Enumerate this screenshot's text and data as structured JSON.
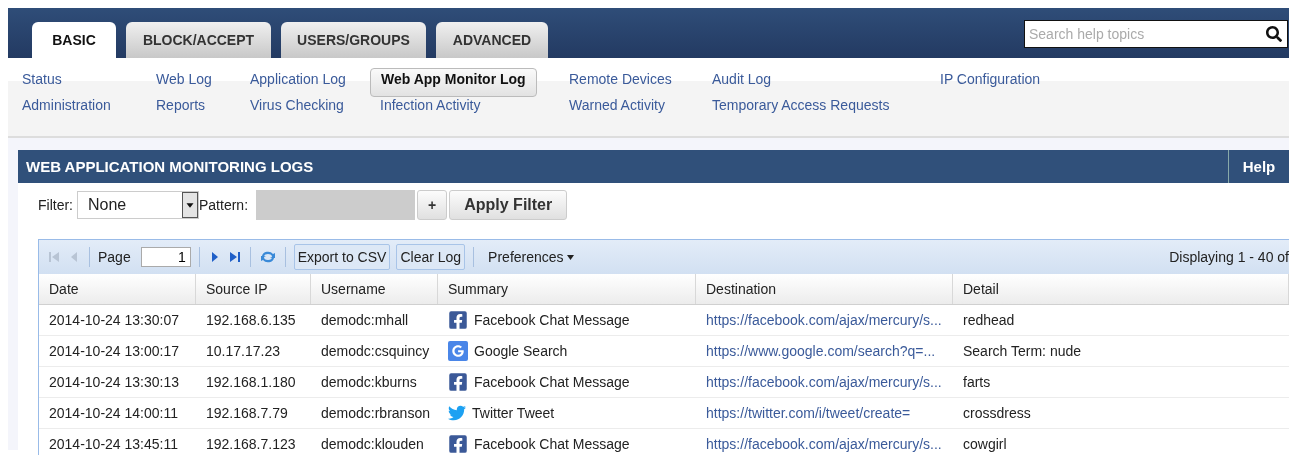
{
  "tabs": [
    {
      "label": "BASIC",
      "selected": true
    },
    {
      "label": "BLOCK/ACCEPT",
      "selected": false
    },
    {
      "label": "USERS/GROUPS",
      "selected": false
    },
    {
      "label": "ADVANCED",
      "selected": false
    }
  ],
  "search": {
    "placeholder": "Search help topics"
  },
  "subnav": [
    {
      "label": "Status",
      "selected": false
    },
    {
      "label": "Web Log",
      "selected": false
    },
    {
      "label": "Application Log",
      "selected": false
    },
    {
      "label": "Web App Monitor Log",
      "selected": true
    },
    {
      "label": "Remote Devices",
      "selected": false
    },
    {
      "label": "Audit Log",
      "selected": false
    },
    {
      "label": "IP Configuration",
      "selected": false
    },
    {
      "label": "Administration",
      "selected": false
    },
    {
      "label": "Reports",
      "selected": false
    },
    {
      "label": "Virus Checking",
      "selected": false
    },
    {
      "label": "Infection Activity",
      "selected": false
    },
    {
      "label": "Warned Activity",
      "selected": false
    },
    {
      "label": "Temporary Access Requests",
      "selected": false
    }
  ],
  "panel": {
    "title": "WEB APPLICATION MONITORING LOGS",
    "help": "Help"
  },
  "filter": {
    "label": "Filter:",
    "value": "None",
    "pattern_label": "Pattern:",
    "pattern_disabled": true,
    "add": "+",
    "apply": "Apply Filter"
  },
  "toolbar": {
    "first_disabled": true,
    "prev_disabled": true,
    "page_label": "Page",
    "page": "1",
    "export": "Export to CSV",
    "clear": "Clear Log",
    "preferences": "Preferences",
    "display": "Displaying 1 - 40 of"
  },
  "table": {
    "columns": [
      "Date",
      "Source IP",
      "Username",
      "Summary",
      "Destination",
      "Detail"
    ],
    "rows": [
      {
        "date": "2014-10-24 13:30:07",
        "ip": "192.168.6.135",
        "user": "demodc:mhall",
        "kind": "facebook",
        "summary": "Facebook Chat Message",
        "destination": "https://facebook.com/ajax/mercury/s...",
        "detail": "redhead"
      },
      {
        "date": "2014-10-24 13:00:17",
        "ip": "10.17.17.23",
        "user": "demodc:csquincy",
        "kind": "google",
        "summary": "Google Search",
        "destination": "https://www.google.com/search?q=...",
        "detail": "Search Term: nude"
      },
      {
        "date": "2014-10-24 13:30:13",
        "ip": "192.168.1.180",
        "user": "demodc:kburns",
        "kind": "facebook",
        "summary": "Facebook Chat Message",
        "destination": "https://facebook.com/ajax/mercury/s...",
        "detail": "farts"
      },
      {
        "date": "2014-10-24 14:00:11",
        "ip": "192.168.7.79",
        "user": "demodc:rbranson",
        "kind": "twitter",
        "summary": "Twitter Tweet",
        "destination": "https://twitter.com/i/tweet/create=",
        "detail": "crossdress"
      },
      {
        "date": "2014-10-24 13:45:11",
        "ip": "192.168.7.123",
        "user": "demodc:klouden",
        "kind": "facebook",
        "summary": "Facebook Chat Message",
        "destination": "https://facebook.com/ajax/mercury/s...",
        "detail": "cowgirl"
      }
    ]
  }
}
